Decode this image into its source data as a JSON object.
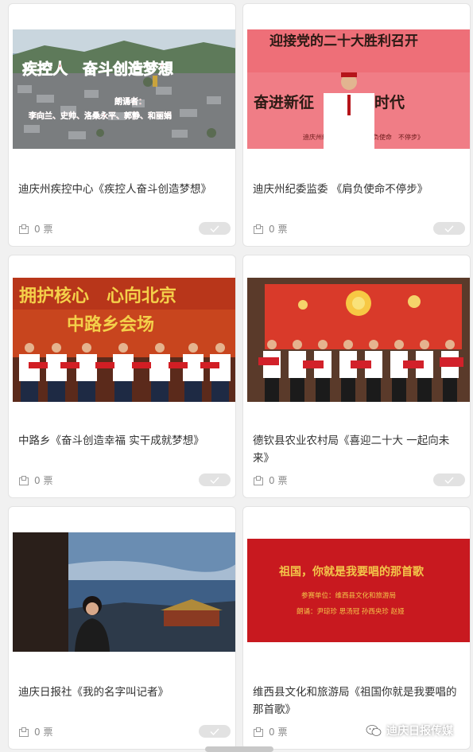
{
  "cards": [
    {
      "title": "迪庆州疾控中心《疾控人奋斗创造梦想》",
      "votes": "0 票",
      "thumb_text": {
        "main": "疾控人　奋斗创造梦想",
        "sub1": "朗诵者：",
        "sub2": "李向兰、史帅、洛桑永平、郭静、和丽娟"
      }
    },
    {
      "title": "迪庆州纪委监委 《肩负使命不停步》",
      "votes": "0 票",
      "thumb_text": {
        "main": "迎接党的二十大胜利召开",
        "sub1": "奋进新征　建设新时代",
        "sub2": "迪庆州纪委监委选送《肩负使命　不停步》"
      }
    },
    {
      "title": "中路乡《奋斗创造幸福 实干成就梦想》",
      "votes": "0 票",
      "thumb_text": {
        "main": "拥护核心　心向北京",
        "sub1": "中路乡会场",
        "sub2": ""
      }
    },
    {
      "title": "德钦县农业农村局《喜迎二十大 一起向未来》",
      "votes": "0 票",
      "thumb_text": {
        "main": "",
        "sub1": "",
        "sub2": ""
      }
    },
    {
      "title": "迪庆日报社《我的名字叫记者》",
      "votes": "0 票",
      "thumb_text": {
        "main": "",
        "sub1": "",
        "sub2": ""
      }
    },
    {
      "title": "维西县文化和旅游局《祖国你就是我要唱的那首歌》",
      "votes": "0 票",
      "thumb_text": {
        "main": "祖国，你就是我要唱的那首歌",
        "sub1": "参赛单位：维西县文化和旅游局",
        "sub2": "朗诵：尹琼珍 思汤冠 孙西央珍 赵娅"
      }
    }
  ],
  "watermark": {
    "label": "迪庆日报传媒"
  },
  "colors": {
    "card_bg": "#ffffff",
    "page_bg": "#f1f1f1",
    "title": "#333333",
    "muted": "#8c8c8c",
    "red": "#c8191f"
  },
  "icons": {
    "vote": "ballot-icon",
    "check": "check-icon",
    "watermark": "wechat-icon"
  }
}
